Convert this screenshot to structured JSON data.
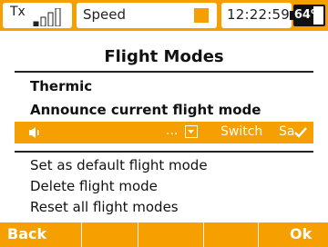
{
  "status_bar": {
    "tx_label": "Tx",
    "model_name": "Speed",
    "time": "12:22:59",
    "battery_percent": "64%",
    "battery_level": 0.64
  },
  "page": {
    "title": "Flight Modes",
    "current_mode": "Thermic",
    "announce_label": "Announce current flight mode",
    "announce_row": {
      "ellipsis": "...",
      "switch_label": "Switch",
      "switch_value": "Sa"
    },
    "menu_items": [
      "Set as default flight mode",
      "Delete flight mode",
      "Reset all flight modes"
    ]
  },
  "footer": {
    "back_label": "Back",
    "ok_label": "Ok"
  },
  "colors": {
    "accent": "#f5a000",
    "text": "#111111",
    "inverse_text": "#ffffff"
  }
}
